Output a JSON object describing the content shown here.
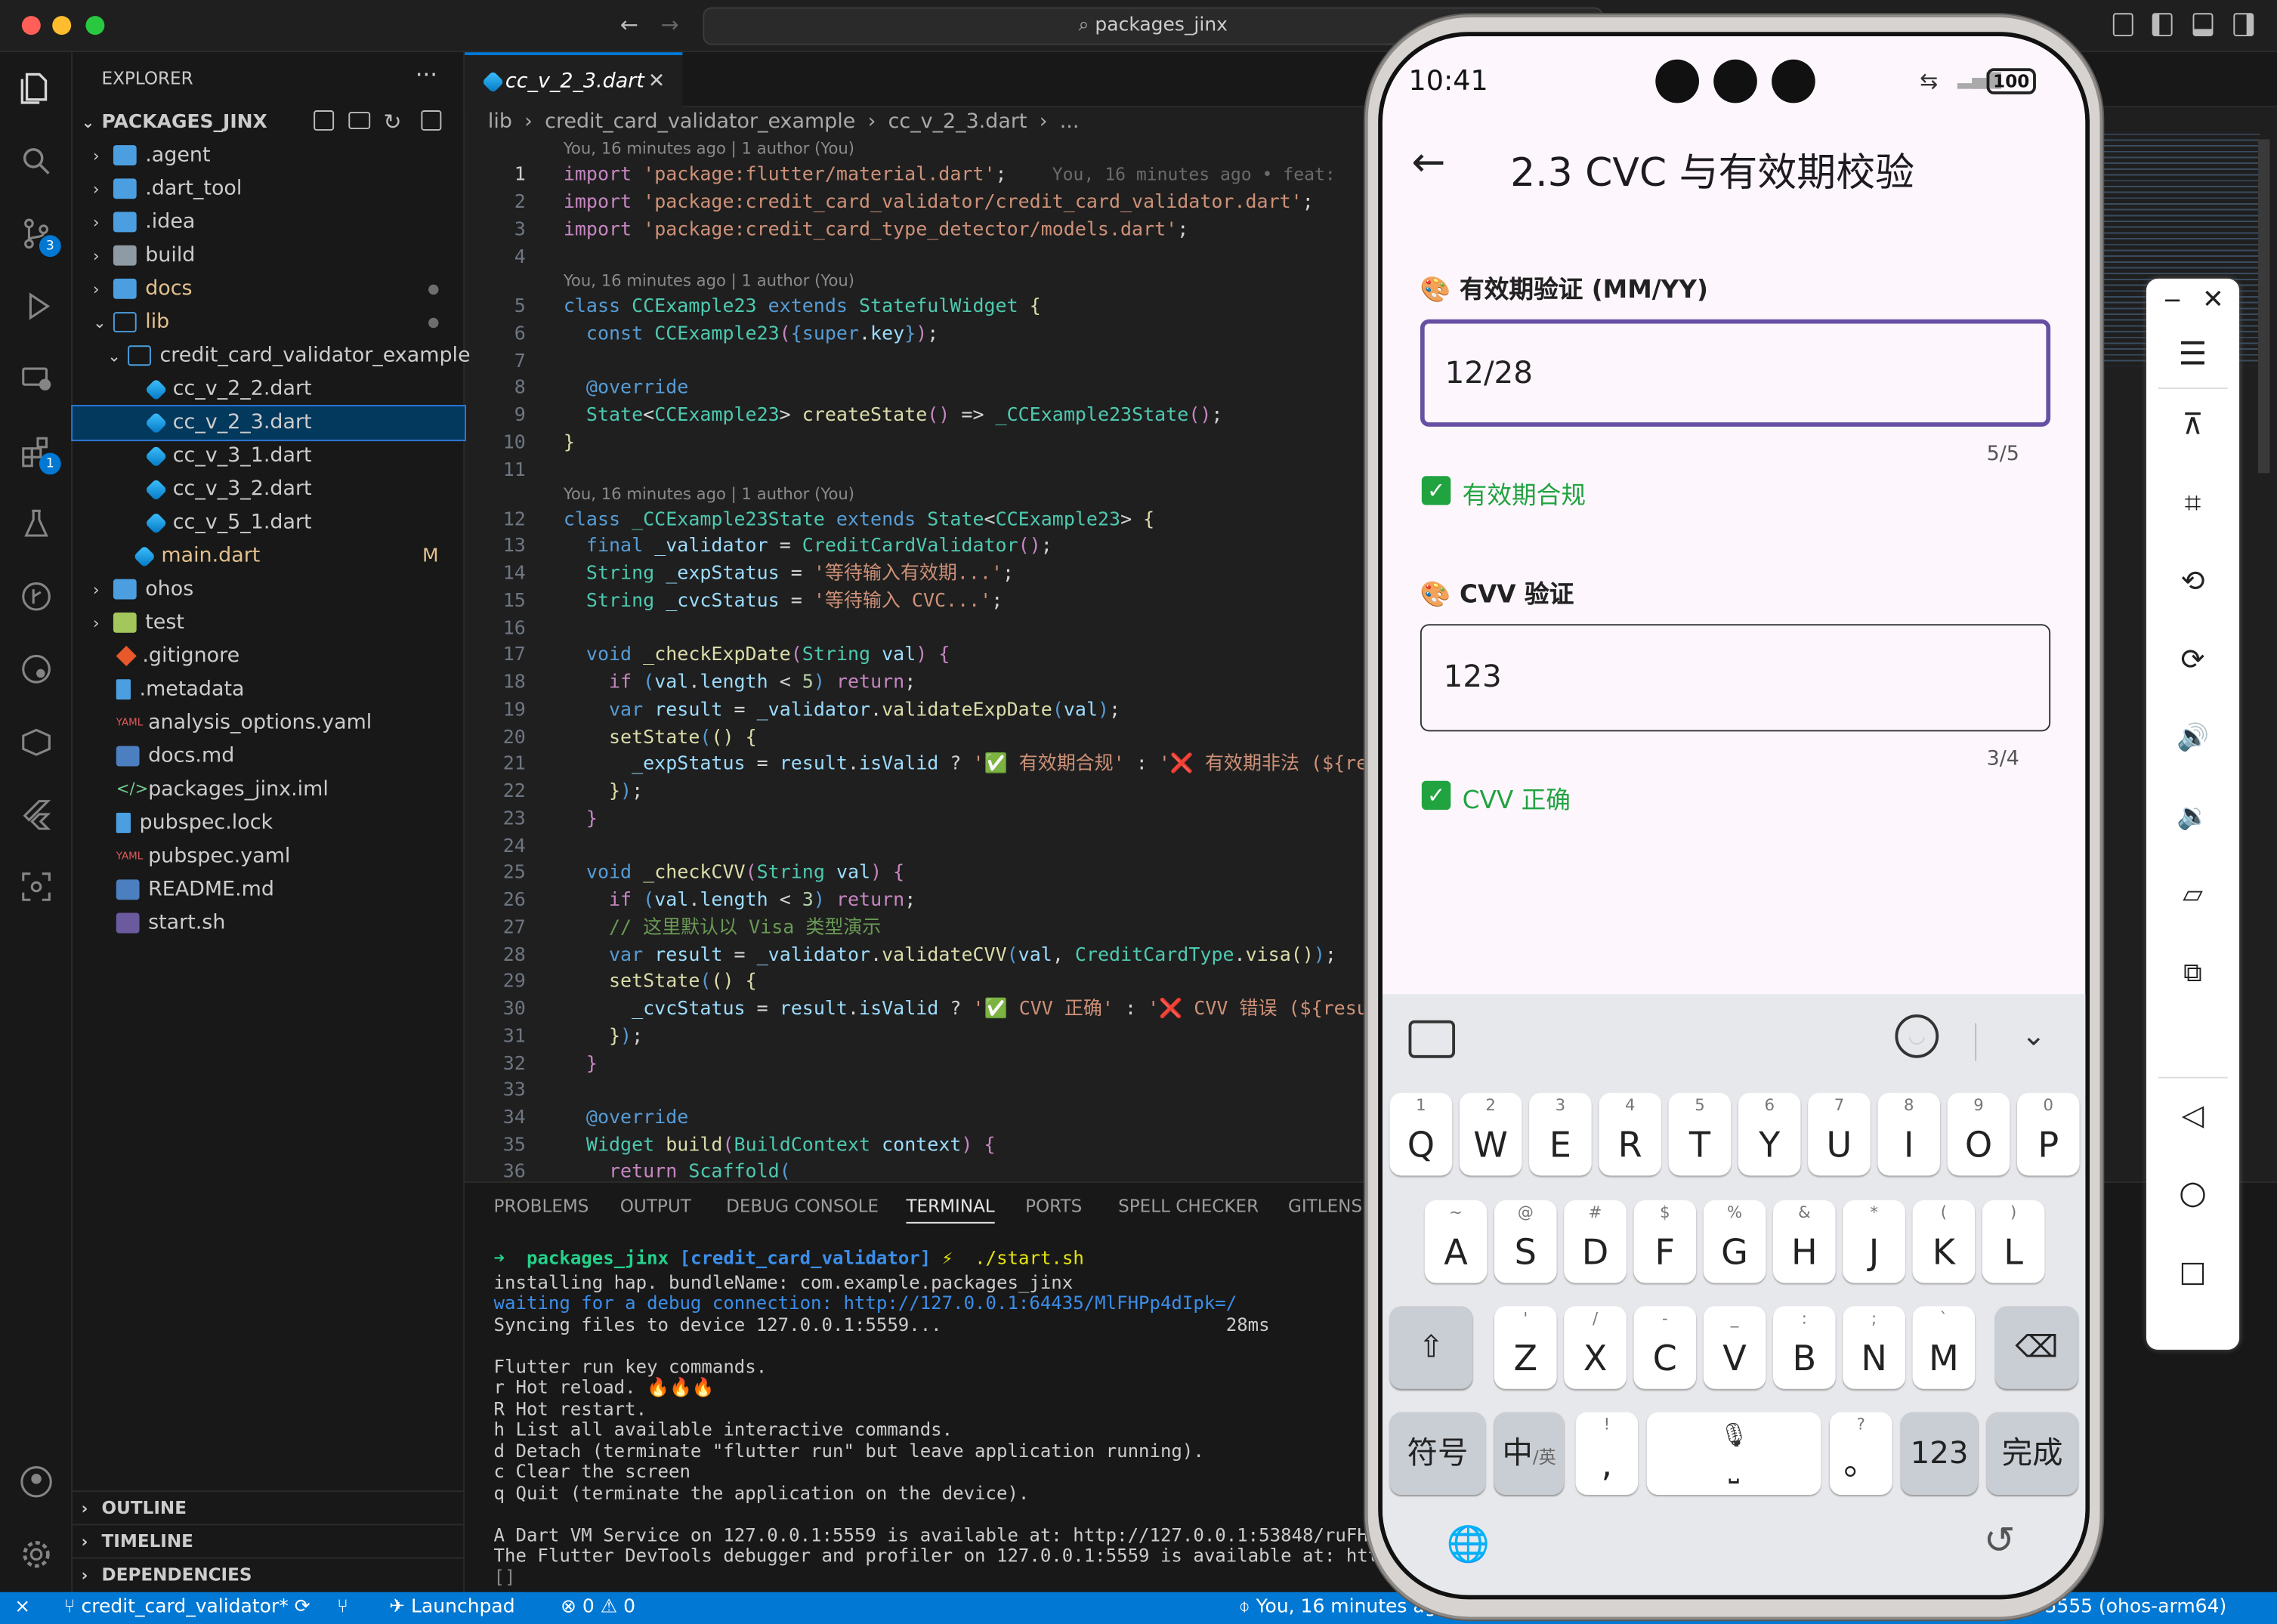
{
  "window": {
    "search_text": "packages_jinx"
  },
  "activity": {
    "scm_badge": "3",
    "ext_badge": "1"
  },
  "explorer": {
    "title": "EXPLORER",
    "root": "PACKAGES_JINX",
    "items": [
      {
        "label": ".agent"
      },
      {
        "label": ".dart_tool"
      },
      {
        "label": ".idea"
      },
      {
        "label": "build"
      },
      {
        "label": "docs"
      },
      {
        "label": "lib"
      },
      {
        "label": "credit_card_validator_example"
      },
      {
        "label": "cc_v_2_2.dart"
      },
      {
        "label": "cc_v_2_3.dart"
      },
      {
        "label": "cc_v_3_1.dart"
      },
      {
        "label": "cc_v_3_2.dart"
      },
      {
        "label": "cc_v_5_1.dart"
      },
      {
        "label": "main.dart",
        "status": "M"
      },
      {
        "label": "ohos"
      },
      {
        "label": "test"
      },
      {
        "label": ".gitignore"
      },
      {
        "label": ".metadata"
      },
      {
        "label": "analysis_options.yaml"
      },
      {
        "label": "docs.md"
      },
      {
        "label": "packages_jinx.iml"
      },
      {
        "label": "pubspec.lock"
      },
      {
        "label": "pubspec.yaml"
      },
      {
        "label": "README.md"
      },
      {
        "label": "start.sh"
      }
    ],
    "sections": [
      "OUTLINE",
      "TIMELINE",
      "DEPENDENCIES"
    ]
  },
  "editor": {
    "tab": "cc_v_2_3.dart",
    "breadcrumb": [
      "lib",
      "credit_card_validator_example",
      "cc_v_2_3.dart",
      "..."
    ],
    "blame1": "You, 16 minutes ago | 1 author (You)",
    "blame2": "You, 16 minutes ago | 1 author (You)",
    "blame3": "You, 16 minutes ago | 1 author (You)",
    "inline_blame": "You, 16 minutes ago • feat:"
  },
  "panel": {
    "tabs": [
      "PROBLEMS",
      "OUTPUT",
      "DEBUG CONSOLE",
      "TERMINAL",
      "PORTS",
      "SPELL CHECKER",
      "GITLENS"
    ],
    "prompt_dir": "packages_jinx",
    "prompt_branch": "[credit_card_validator]",
    "prompt_cmd": "./start.sh",
    "lines": [
      "installing hap. bundleName: com.example.packages_jinx",
      "waiting for a debug connection: http://127.0.0.1:64435/MlFHPp4dIpk=/",
      "Syncing files to device 127.0.0.1:5559...                          28ms",
      "",
      "Flutter run key commands.",
      "r Hot reload. 🔥🔥🔥",
      "R Hot restart.",
      "h List all available interactive commands.",
      "d Detach (terminate \"flutter run\" but leave application running).",
      "c Clear the screen",
      "q Quit (terminate the application on the device).",
      "",
      "A Dart VM Service on 127.0.0.1:5559 is available at: http://127.0.0.1:53848/ruFHhM",
      "The Flutter DevTools debugger and profiler on 127.0.0.1:5559 is available at: http:",
      "[]"
    ]
  },
  "statusbar": {
    "branch": "credit_card_validator*",
    "launchpad": "Launchpad",
    "errors": "0",
    "warnings": "0",
    "blame": "You, 16 minutes ag",
    "device": "5555 (ohos-arm64)"
  },
  "phone": {
    "time": "10:41",
    "battery": "100",
    "app_title": "2.3 CVC 与有效期校验",
    "exp_label": "🎨 有效期验证 (MM/YY)",
    "exp_value": "12/28",
    "exp_counter": "5/5",
    "exp_status": "有效期合规",
    "cvv_label": "🎨 CVV 验证",
    "cvv_value": "123",
    "cvv_counter": "3/4",
    "cvv_status": "CVV 正确",
    "keyboard": {
      "row1": [
        [
          "1",
          "Q"
        ],
        [
          "2",
          "W"
        ],
        [
          "3",
          "E"
        ],
        [
          "4",
          "R"
        ],
        [
          "5",
          "T"
        ],
        [
          "6",
          "Y"
        ],
        [
          "7",
          "U"
        ],
        [
          "8",
          "I"
        ],
        [
          "9",
          "O"
        ],
        [
          "0",
          "P"
        ]
      ],
      "row2": [
        [
          "~",
          "A"
        ],
        [
          "@",
          "S"
        ],
        [
          "#",
          "D"
        ],
        [
          "$",
          "F"
        ],
        [
          "%",
          "G"
        ],
        [
          "&",
          "H"
        ],
        [
          "*",
          "J"
        ],
        [
          "(",
          "K"
        ],
        [
          ")",
          "L"
        ]
      ],
      "row3": [
        [
          "'",
          "Z"
        ],
        [
          "/",
          "X"
        ],
        [
          "-",
          "C"
        ],
        [
          "_",
          "V"
        ],
        [
          ":",
          "B"
        ],
        [
          ";",
          "N"
        ],
        [
          "`",
          "M"
        ]
      ],
      "symbols": "符号",
      "lang": "中",
      "lang_sub": "/英",
      "comma": ",",
      "comma_sub": "!",
      "period": "。",
      "period_sub": "?",
      "num": "123",
      "done": "完成"
    }
  }
}
